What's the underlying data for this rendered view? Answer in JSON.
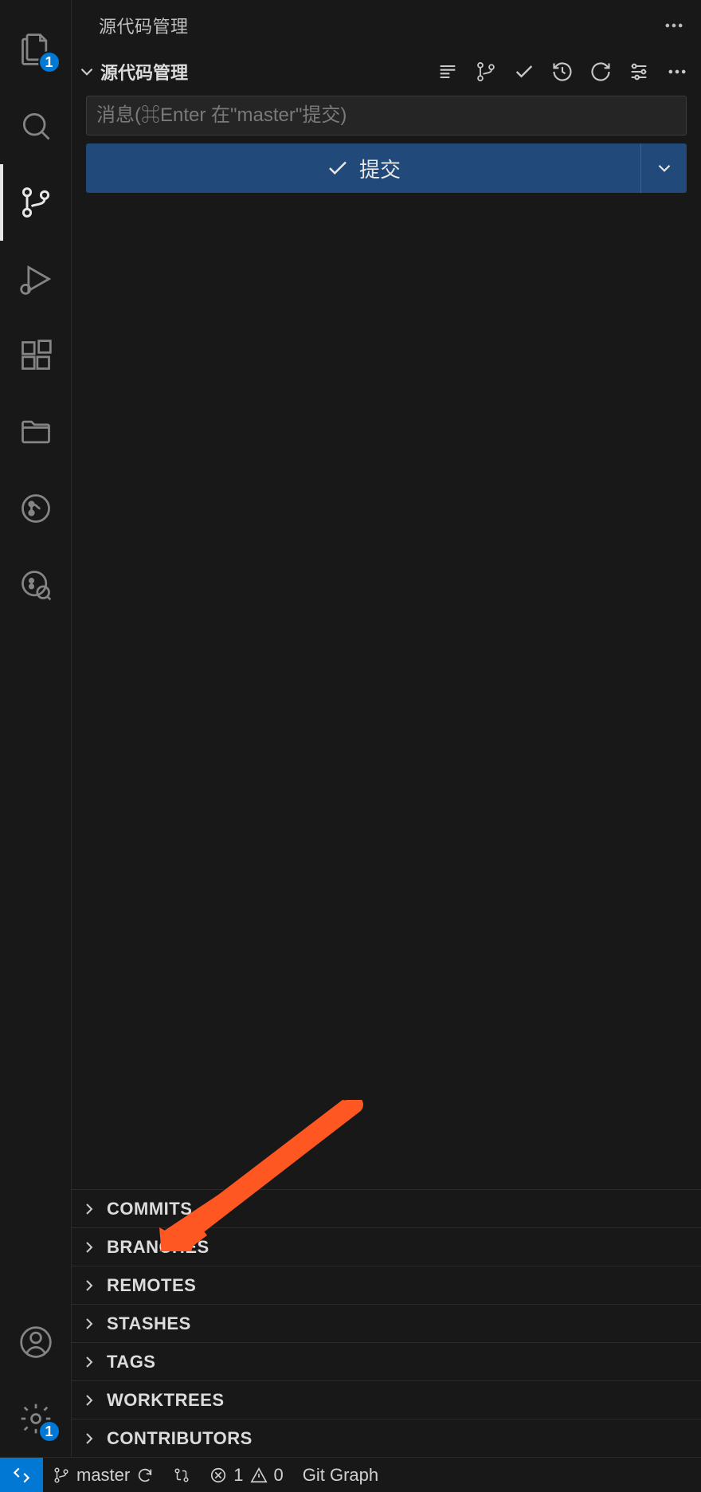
{
  "activityBar": {
    "explorerBadge": "1",
    "settingsBadge": "1"
  },
  "panel": {
    "title": "源代码管理",
    "sectionTitle": "源代码管理",
    "commitPlaceholder": "消息(⌘Enter 在\"master\"提交)",
    "commitButton": "提交",
    "sections": [
      "COMMITS",
      "BRANCHES",
      "REMOTES",
      "STASHES",
      "TAGS",
      "WORKTREES",
      "CONTRIBUTORS"
    ]
  },
  "statusBar": {
    "branch": "master",
    "errors": "1",
    "warnings": "0",
    "gitGraph": "Git Graph"
  }
}
